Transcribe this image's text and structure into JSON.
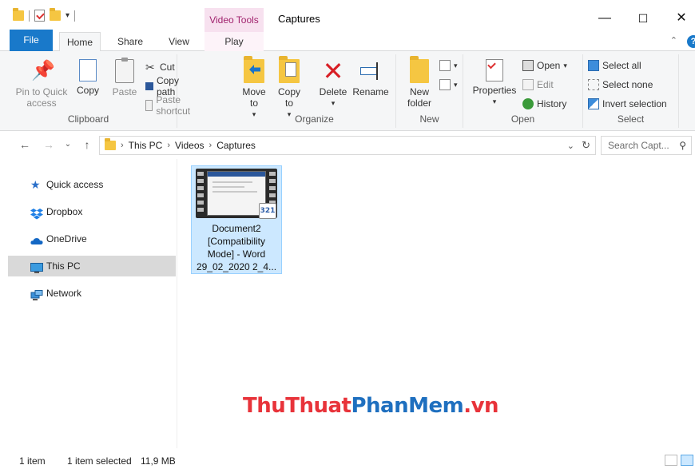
{
  "titlebar": {
    "context_tab": "Video Tools",
    "window_title": "Captures",
    "minimize": "—",
    "maximize": "☐",
    "close": "✕"
  },
  "tabs": {
    "file": "File",
    "home": "Home",
    "share": "Share",
    "view": "View",
    "play": "Play"
  },
  "ribbon": {
    "clipboard": {
      "label": "Clipboard",
      "pin": "Pin to Quick access",
      "copy": "Copy",
      "paste": "Paste",
      "cut": "Cut",
      "copy_path": "Copy path",
      "paste_shortcut": "Paste shortcut"
    },
    "organize": {
      "label": "Organize",
      "move_to": "Move to",
      "copy_to": "Copy to",
      "delete": "Delete",
      "rename": "Rename"
    },
    "new": {
      "label": "New",
      "new_folder": "New folder"
    },
    "open": {
      "label": "Open",
      "properties": "Properties",
      "open": "Open",
      "edit": "Edit",
      "history": "History"
    },
    "select": {
      "label": "Select",
      "select_all": "Select all",
      "select_none": "Select none",
      "invert_selection": "Invert selection"
    }
  },
  "address": {
    "crumbs": [
      "This PC",
      "Videos",
      "Captures"
    ],
    "search_placeholder": "Search Capt..."
  },
  "nav": {
    "items": [
      {
        "label": "Quick access",
        "icon": "star-icon"
      },
      {
        "label": "Dropbox",
        "icon": "dropbox-icon"
      },
      {
        "label": "OneDrive",
        "icon": "cloud-icon"
      },
      {
        "label": "This PC",
        "icon": "computer-icon"
      },
      {
        "label": "Network",
        "icon": "network-icon"
      }
    ]
  },
  "file": {
    "name_lines": [
      "Document2",
      "[Compatibility",
      "Mode] - Word",
      "29_02_2020 2_4..."
    ],
    "badge": "321"
  },
  "watermark": {
    "part1": "ThuThuat",
    "part2": "PhanMem",
    "part3": ".vn"
  },
  "status": {
    "count": "1 item",
    "selected": "1 item selected",
    "size": "11,9 MB"
  },
  "colors": {
    "accent": "#1979ca",
    "context_tab": "#a1236e",
    "selection": "#cce8ff"
  }
}
